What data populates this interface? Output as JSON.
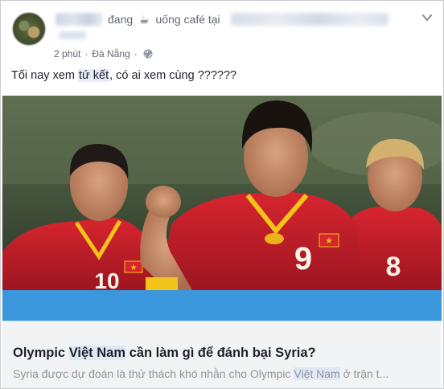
{
  "post": {
    "action_text_before": "đang",
    "action_icon": "coffee-icon",
    "action_text_after": "uống café tại",
    "action_place_blurred_prefix": "Đ",
    "time": "2 phút",
    "location": "Đà Nẵng",
    "privacy_icon": "globe-icon",
    "menu_icon": "chevron-down-icon"
  },
  "message": {
    "before": "Tối nay xem ",
    "highlight": "tứ kết",
    "after": ", có ai xem cùng ??????"
  },
  "link_preview": {
    "title_before": "Olympic ",
    "title_highlight": "Việt Nam",
    "title_after": " cần làm gì để đánh bại Syria?",
    "desc_before": "Syria được dự đoán là thử thách khó nhằn cho Olympic ",
    "desc_highlight": "Việt Nam",
    "desc_after": " ở trận t..."
  },
  "photo": {
    "jersey_numbers": [
      "10",
      "9",
      "8"
    ],
    "colors": {
      "jersey": "#c8202a",
      "trim": "#f2c318",
      "background": "#4c5d3f",
      "link_bar": "#3a97dc"
    }
  }
}
